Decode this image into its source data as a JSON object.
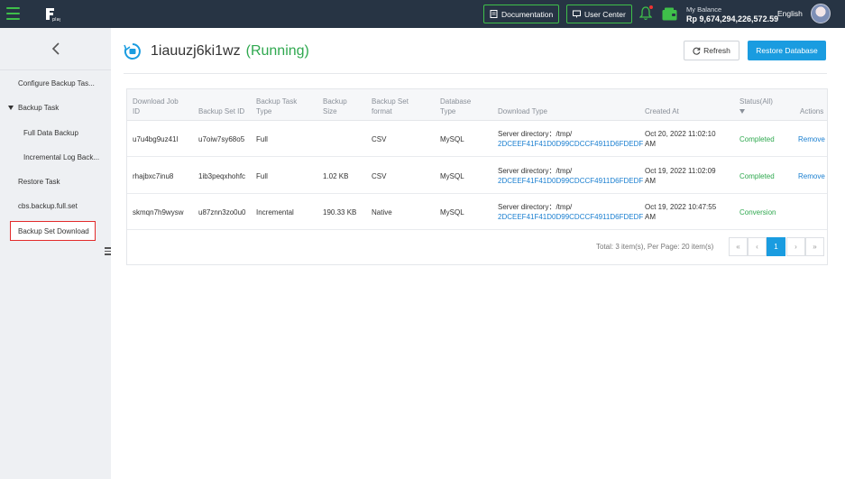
{
  "topbar": {
    "documentation": "Documentation",
    "user_center": "User Center",
    "balance_label": "My Balance",
    "balance_value": "Rp 9,674,294,226,572.59",
    "language": "English"
  },
  "sidebar": {
    "items": [
      {
        "label": "Configure Backup Tas..."
      },
      {
        "label": "Backup Task"
      },
      {
        "label": "Full Data Backup"
      },
      {
        "label": "Incremental Log Back..."
      },
      {
        "label": "Restore Task"
      },
      {
        "label": "cbs.backup.full.set"
      },
      {
        "label": "Backup Set Download"
      }
    ]
  },
  "main": {
    "title": "1iauuzj6ki1wz",
    "status": "(Running)",
    "refresh_label": "Refresh",
    "restore_label": "Restore Database"
  },
  "table": {
    "headers": {
      "job_id_1": "Download Job",
      "job_id_2": "ID",
      "set_id": "Backup Set ID",
      "task_type_1": "Backup Task",
      "task_type_2": "Type",
      "size_1": "Backup",
      "size_2": "Size",
      "format_1": "Backup Set",
      "format_2": "format",
      "db_type_1": "Database",
      "db_type_2": "Type",
      "download_type": "Download Type",
      "created_at": "Created At",
      "status": "Status(All)",
      "actions": "Actions"
    },
    "rows": [
      {
        "job_id": "u7u4bg9uz41l",
        "set_id": "u7oiw7sy68o5",
        "task_type": "Full",
        "size": "",
        "format": "CSV",
        "db_type": "MySQL",
        "dl_prefix": "Server directory：/tmp/",
        "dl_path": "2DCEEF41F41D0D99CDCCF4911D6FDEDF",
        "created_1": "Oct 20, 2022 11:02:10",
        "created_2": "AM",
        "status": "Completed",
        "action": "Remove"
      },
      {
        "job_id": "rhajbxc7inu8",
        "set_id": "1ib3peqxhohfc",
        "task_type": "Full",
        "size": "1.02 KB",
        "format": "CSV",
        "db_type": "MySQL",
        "dl_prefix": "Server directory：/tmp/",
        "dl_path": "2DCEEF41F41D0D99CDCCF4911D6FDEDF",
        "created_1": "Oct 19, 2022 11:02:09",
        "created_2": "AM",
        "status": "Completed",
        "action": "Remove"
      },
      {
        "job_id": "skmqn7h9wysw",
        "set_id": "u87znn3zo0u0",
        "task_type": "Incremental",
        "size": "190.33 KB",
        "format": "Native",
        "db_type": "MySQL",
        "dl_prefix": "Server directory：/tmp/",
        "dl_path": "2DCEEF41F41D0D99CDCCF4911D6FDEDF",
        "created_1": "Oct 19, 2022 10:47:55",
        "created_2": "AM",
        "status": "Conversion",
        "action": ""
      }
    ],
    "pagination": {
      "total_text": "Total: 3 item(s), Per Page: 20 item(s)",
      "first": "«",
      "prev": "‹",
      "current": "1",
      "next": "›",
      "last": "»"
    }
  },
  "colors": {
    "topbar": "#273444",
    "accent_green": "#3fbf4a",
    "primary_blue": "#1a9ce0",
    "status_green": "#2fa84f",
    "active_border": "#e32b2b"
  },
  "icons": [
    "menu-icon",
    "logo-icon",
    "document-icon",
    "monitor-icon",
    "bell-icon",
    "wallet-icon",
    "chevron-left-icon",
    "refresh-icon",
    "sync-icon",
    "sort-icon"
  ]
}
